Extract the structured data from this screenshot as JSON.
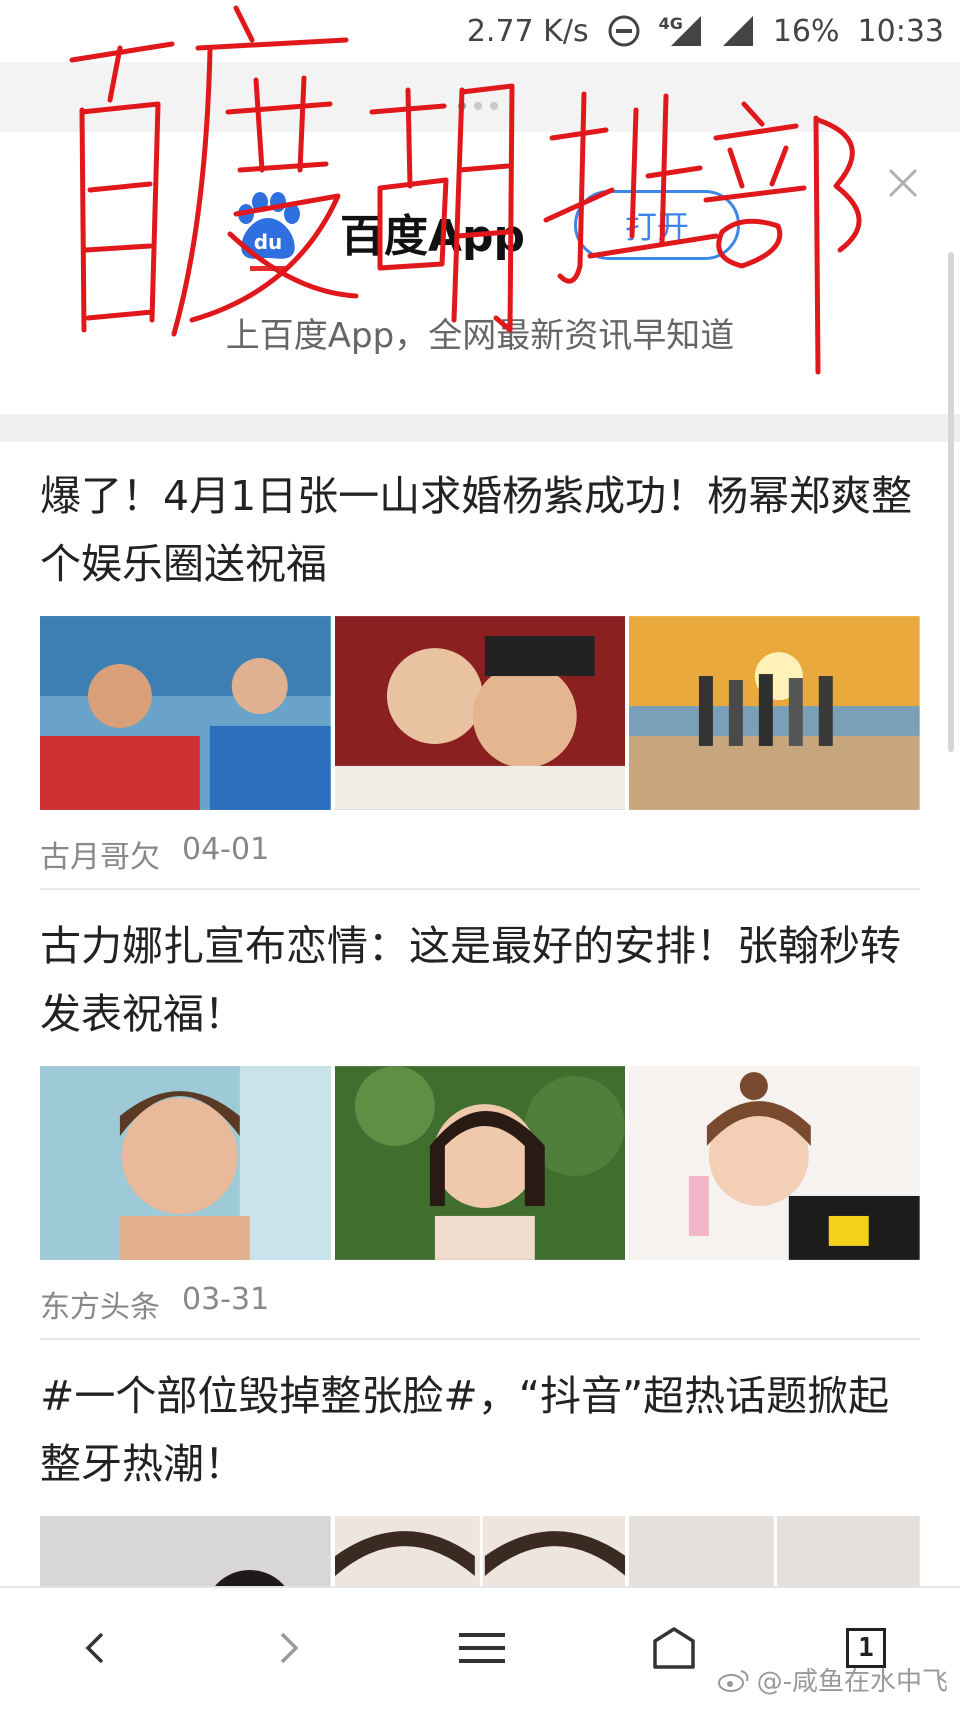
{
  "status_bar": {
    "net_speed": "2.77 K/s",
    "network_type": "4G",
    "battery": "16%",
    "time": "10:33"
  },
  "banner": {
    "app_name": "百度App",
    "open_label": "打开",
    "tagline": "上百度App，全网最新资讯早知道",
    "logo_text": "du",
    "brand_color": "#3b86e6"
  },
  "handwriting_overlay": {
    "text": "百度胡扯部",
    "color": "#e0171b"
  },
  "articles": [
    {
      "title": "爆了！4月1日张一山求婚杨紫成功！杨幂郑爽整个娱乐圈送祝福",
      "source": "古月哥欠",
      "date": "04-01"
    },
    {
      "title": "古力娜扎宣布恋情：这是最好的安排！张翰秒转发表祝福！",
      "source": "东方头条",
      "date": "03-31"
    },
    {
      "title": "#一个部位毁掉整张脸#，“抖音”超热话题掀起整牙热潮！"
    }
  ],
  "navbar": {
    "tab_count": "1"
  },
  "watermark": {
    "text": "@-咸鱼在水中飞"
  }
}
